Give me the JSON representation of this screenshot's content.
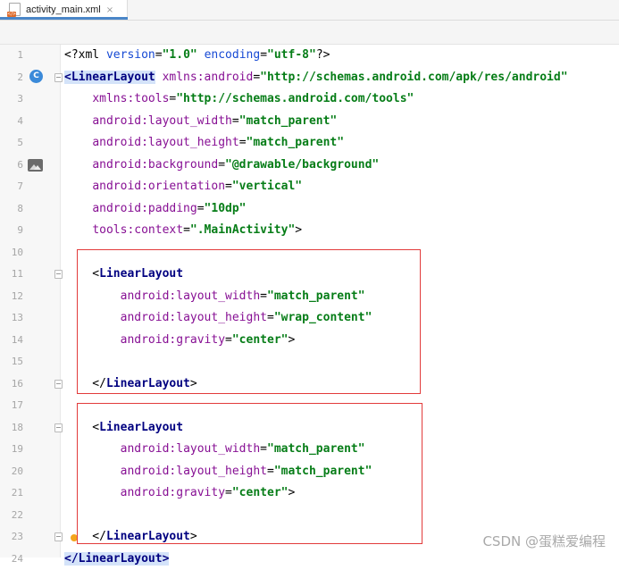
{
  "tab": {
    "filename": "activity_main.xml",
    "close_glyph": "×",
    "file_badge": "</>"
  },
  "lines": [
    {
      "num": "1",
      "parts": [
        [
          "punct",
          "<?xml "
        ],
        [
          "attr",
          "version"
        ],
        [
          "punct",
          "="
        ],
        [
          "val",
          "\"1.0\""
        ],
        [
          "punct",
          " "
        ],
        [
          "attr",
          "encoding"
        ],
        [
          "punct",
          "="
        ],
        [
          "val",
          "\"utf-8\""
        ],
        [
          "punct",
          "?>"
        ]
      ]
    },
    {
      "num": "2",
      "parts": [
        [
          "hl",
          "<LinearLayout"
        ],
        [
          "punct",
          " "
        ],
        [
          "ns",
          "xmlns:android"
        ],
        [
          "punct",
          "="
        ],
        [
          "val",
          "\"http://schemas.android.com/apk/res/android\""
        ]
      ]
    },
    {
      "num": "3",
      "parts": [
        [
          "punct",
          "    "
        ],
        [
          "ns",
          "xmlns:tools"
        ],
        [
          "punct",
          "="
        ],
        [
          "val",
          "\"http://schemas.android.com/tools\""
        ]
      ]
    },
    {
      "num": "4",
      "parts": [
        [
          "punct",
          "    "
        ],
        [
          "ns",
          "android:layout_width"
        ],
        [
          "punct",
          "="
        ],
        [
          "val",
          "\"match_parent\""
        ]
      ]
    },
    {
      "num": "5",
      "parts": [
        [
          "punct",
          "    "
        ],
        [
          "ns",
          "android:layout_height"
        ],
        [
          "punct",
          "="
        ],
        [
          "val",
          "\"match_parent\""
        ]
      ]
    },
    {
      "num": "6",
      "parts": [
        [
          "punct",
          "    "
        ],
        [
          "ns",
          "android:background"
        ],
        [
          "punct",
          "="
        ],
        [
          "val",
          "\"@drawable/background\""
        ]
      ]
    },
    {
      "num": "7",
      "parts": [
        [
          "punct",
          "    "
        ],
        [
          "ns",
          "android:orientation"
        ],
        [
          "punct",
          "="
        ],
        [
          "val",
          "\"vertical\""
        ]
      ]
    },
    {
      "num": "8",
      "parts": [
        [
          "punct",
          "    "
        ],
        [
          "ns",
          "android:padding"
        ],
        [
          "punct",
          "="
        ],
        [
          "val",
          "\"10dp\""
        ]
      ]
    },
    {
      "num": "9",
      "parts": [
        [
          "punct",
          "    "
        ],
        [
          "ns",
          "tools:context"
        ],
        [
          "punct",
          "="
        ],
        [
          "val",
          "\".MainActivity\""
        ],
        [
          "punct",
          ">"
        ]
      ]
    },
    {
      "num": "10",
      "parts": []
    },
    {
      "num": "11",
      "parts": [
        [
          "punct",
          "    <"
        ],
        [
          "tag",
          "LinearLayout"
        ]
      ]
    },
    {
      "num": "12",
      "parts": [
        [
          "punct",
          "        "
        ],
        [
          "ns",
          "android:layout_width"
        ],
        [
          "punct",
          "="
        ],
        [
          "val",
          "\"match_parent\""
        ]
      ]
    },
    {
      "num": "13",
      "parts": [
        [
          "punct",
          "        "
        ],
        [
          "ns",
          "android:layout_height"
        ],
        [
          "punct",
          "="
        ],
        [
          "val",
          "\"wrap_content\""
        ]
      ]
    },
    {
      "num": "14",
      "parts": [
        [
          "punct",
          "        "
        ],
        [
          "ns",
          "android:gravity"
        ],
        [
          "punct",
          "="
        ],
        [
          "val",
          "\"center\""
        ],
        [
          "punct",
          ">"
        ]
      ]
    },
    {
      "num": "15",
      "parts": []
    },
    {
      "num": "16",
      "parts": [
        [
          "punct",
          "    </"
        ],
        [
          "tag",
          "LinearLayout"
        ],
        [
          "punct",
          ">"
        ]
      ]
    },
    {
      "num": "17",
      "parts": []
    },
    {
      "num": "18",
      "parts": [
        [
          "punct",
          "    <"
        ],
        [
          "tag",
          "LinearLayout"
        ]
      ]
    },
    {
      "num": "19",
      "parts": [
        [
          "punct",
          "        "
        ],
        [
          "ns",
          "android:layout_width"
        ],
        [
          "punct",
          "="
        ],
        [
          "val",
          "\"match_parent\""
        ]
      ]
    },
    {
      "num": "20",
      "parts": [
        [
          "punct",
          "        "
        ],
        [
          "ns",
          "android:layout_height"
        ],
        [
          "punct",
          "="
        ],
        [
          "val",
          "\"match_parent\""
        ]
      ]
    },
    {
      "num": "21",
      "parts": [
        [
          "punct",
          "        "
        ],
        [
          "ns",
          "android:gravity"
        ],
        [
          "punct",
          "="
        ],
        [
          "val",
          "\"center\""
        ],
        [
          "punct",
          ">"
        ]
      ]
    },
    {
      "num": "22",
      "parts": []
    },
    {
      "num": "23",
      "parts": [
        [
          "punct",
          "    </"
        ],
        [
          "tag",
          "LinearLayout"
        ],
        [
          "punct",
          ">"
        ]
      ]
    },
    {
      "num": "24",
      "parts": [
        [
          "hl",
          "</LinearLayout>"
        ]
      ]
    }
  ],
  "gutter_markers": {
    "c_badge": "C",
    "c_line": "2",
    "image_line": "6",
    "bulb_line": "23"
  },
  "watermark": "CSDN @蛋糕爱编程",
  "colors": {
    "tag": "#000080",
    "namespace_attr": "#871094",
    "value": "#067d17",
    "highlight_box": "#e23b3b"
  }
}
